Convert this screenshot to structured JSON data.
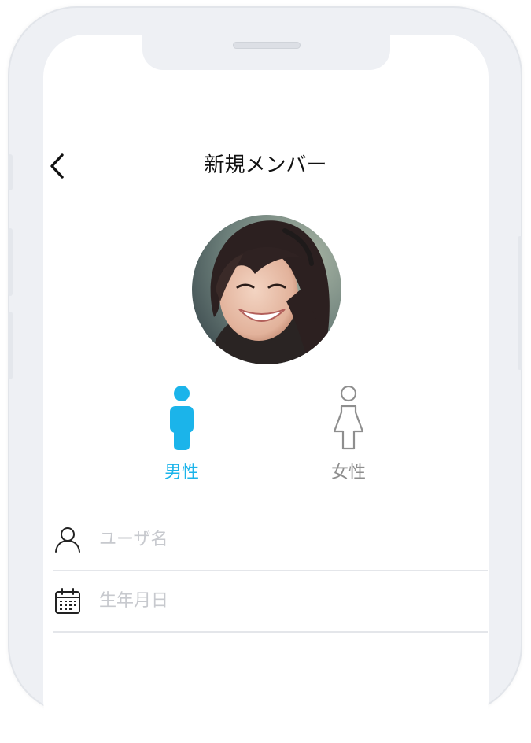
{
  "header": {
    "title": "新規メンバー"
  },
  "profile": {
    "avatar_alt": ""
  },
  "gender": {
    "options": [
      {
        "label": "男性",
        "selected": true
      },
      {
        "label": "女性",
        "selected": false
      }
    ],
    "selected_color": "#1bb4ea",
    "unselected_color": "#8e8e8e"
  },
  "form": {
    "username_placeholder": "ユーザ名",
    "birthday_placeholder": "生年月日"
  },
  "icons": {
    "back": "chevron-left-icon",
    "user": "user-icon",
    "calendar": "calendar-icon",
    "male": "male-icon",
    "female": "female-icon"
  }
}
